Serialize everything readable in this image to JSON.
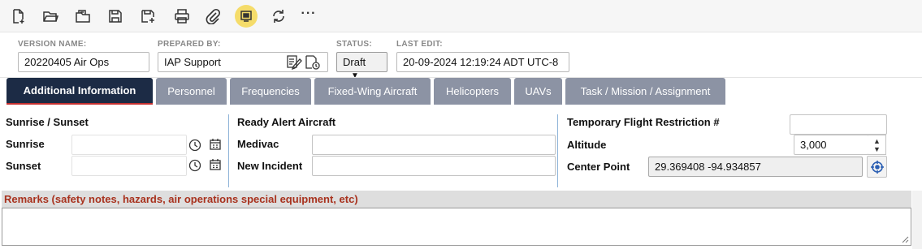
{
  "toolbar": {
    "buttons": [
      {
        "name": "new-document",
        "icon": "new-document-icon"
      },
      {
        "name": "open-folder",
        "icon": "folder-open-icon"
      },
      {
        "name": "open-documents",
        "icon": "documents-folder-icon"
      },
      {
        "name": "save",
        "icon": "save-icon"
      },
      {
        "name": "save-as",
        "icon": "save-as-icon"
      },
      {
        "name": "print",
        "icon": "printer-icon"
      },
      {
        "name": "attach",
        "icon": "paperclip-icon"
      },
      {
        "name": "display",
        "icon": "monitor-icon",
        "active": true
      },
      {
        "name": "sync",
        "icon": "refresh-icon"
      },
      {
        "name": "more",
        "icon": "more-icon",
        "label": "···"
      }
    ],
    "active_color": "#f5dc6a"
  },
  "header": {
    "version_name": {
      "label": "VERSION NAME:",
      "value": "20220405 Air Ops"
    },
    "prepared_by": {
      "label": "PREPARED BY:",
      "value": "IAP Support"
    },
    "status": {
      "label": "STATUS:",
      "value": "Draft"
    },
    "last_edit": {
      "label": "LAST EDIT:",
      "value": "20-09-2024 12:19:24 ADT UTC-8"
    }
  },
  "tabs": [
    {
      "label": "Additional Information",
      "active": true
    },
    {
      "label": "Personnel"
    },
    {
      "label": "Frequencies"
    },
    {
      "label": "Fixed-Wing Aircraft"
    },
    {
      "label": "Helicopters"
    },
    {
      "label": "UAVs"
    },
    {
      "label": "Task / Mission / Assignment"
    }
  ],
  "colors": {
    "tab_active": "#1c2b45",
    "tab_inactive": "#8c93a4",
    "tab_active_underline": "#c53030",
    "remarks_label": "#a8321e",
    "divider": "#8fb4d8"
  },
  "sunrise_sunset": {
    "title": "Sunrise / Sunset",
    "sunrise_label": "Sunrise",
    "sunrise_value": "",
    "sunset_label": "Sunset",
    "sunset_value": ""
  },
  "ready_alert": {
    "title": "Ready Alert Aircraft",
    "medivac_label": "Medivac",
    "medivac_value": "",
    "new_incident_label": "New Incident",
    "new_incident_value": ""
  },
  "tfr": {
    "title": "Temporary Flight Restriction #",
    "tfr_value": "",
    "altitude_label": "Altitude",
    "altitude_value": "3,000",
    "center_point_label": "Center Point",
    "center_point_value": "29.369408 -94.934857"
  },
  "remarks": {
    "label": "Remarks (safety notes, hazards, air operations special equipment, etc)",
    "value": ""
  }
}
